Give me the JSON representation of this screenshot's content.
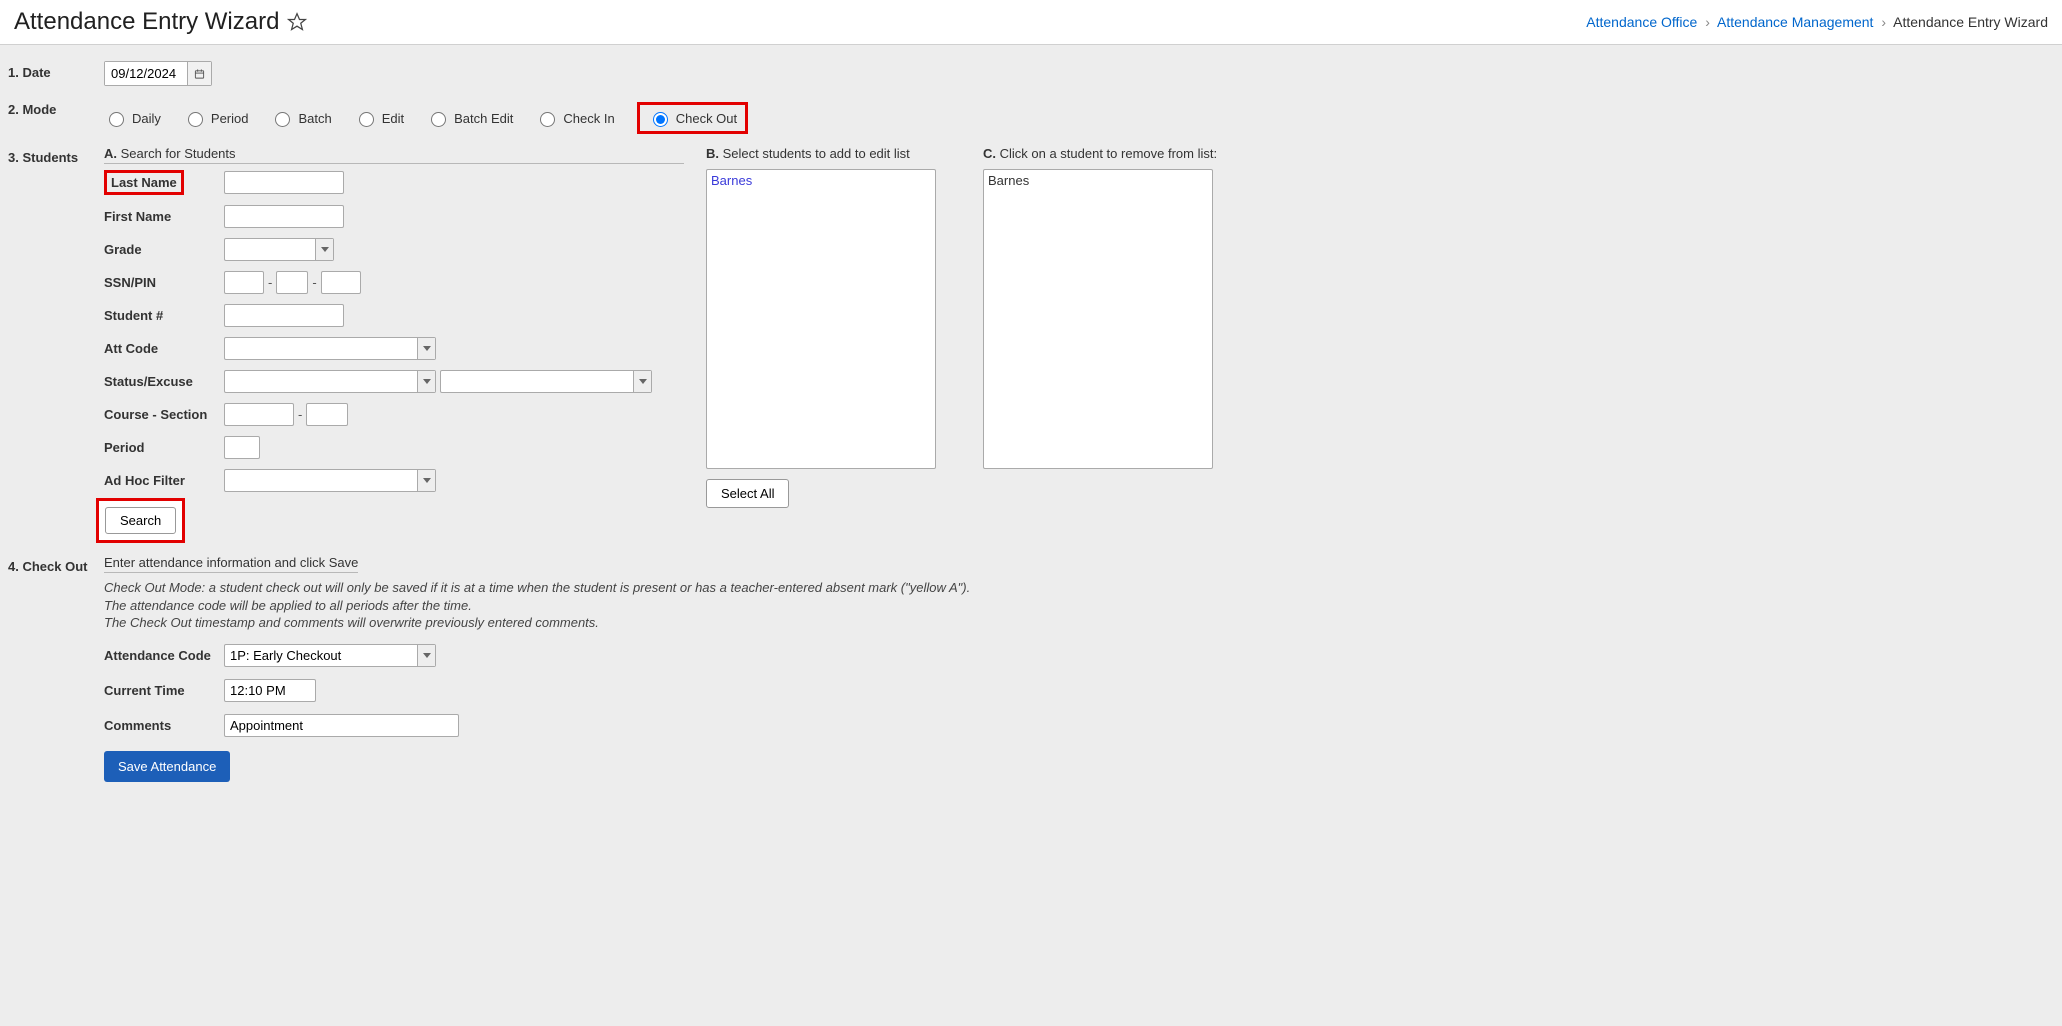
{
  "header": {
    "title": "Attendance Entry Wizard",
    "breadcrumb": [
      {
        "label": "Attendance Office",
        "link": true
      },
      {
        "label": "Attendance Management",
        "link": true
      },
      {
        "label": "Attendance Entry Wizard",
        "link": false
      }
    ]
  },
  "sections": {
    "date_label": "1. Date",
    "mode_label": "2. Mode",
    "students_label": "3. Students",
    "checkout_label": "4. Check Out"
  },
  "date": {
    "value": "09/12/2024"
  },
  "modes": {
    "daily": "Daily",
    "period": "Period",
    "batch": "Batch",
    "edit": "Edit",
    "batch_edit": "Batch Edit",
    "check_in": "Check In",
    "check_out": "Check Out",
    "selected": "check_out"
  },
  "students": {
    "a_head_prefix": "A.",
    "a_head_text": " Search for Students",
    "b_head_prefix": "B.",
    "b_head_text": " Select students to add to edit list",
    "c_head_prefix": "C.",
    "c_head_text": " Click on a student to remove from list:",
    "fields": {
      "last_name": "Last Name",
      "first_name": "First Name",
      "grade": "Grade",
      "ssn": "SSN/PIN",
      "student_no": "Student #",
      "att_code": "Att Code",
      "status_excuse": "Status/Excuse",
      "course_section": "Course - Section",
      "period": "Period",
      "ad_hoc": "Ad Hoc Filter"
    },
    "values": {
      "last_name": "",
      "first_name": "",
      "grade": "",
      "ssn1": "",
      "ssn2": "",
      "ssn3": "",
      "student_no": "",
      "att_code": "",
      "status": "",
      "excuse": "",
      "course": "",
      "section": "",
      "period": "",
      "ad_hoc": ""
    },
    "search_btn": "Search",
    "select_all_btn": "Select All",
    "result_list": [
      {
        "label": "Barnes"
      }
    ],
    "edit_list": [
      {
        "label": "Barnes"
      }
    ]
  },
  "checkout": {
    "hint": "Enter attendance information and click Save",
    "note_line1": "Check Out Mode: a student check out will only be saved if it is at a time when the student is present or has a teacher-entered absent mark (\"yellow A\").",
    "note_line2": "The attendance code will be applied to all periods after the time.",
    "note_line3": "The Check Out timestamp and comments will overwrite previously entered comments.",
    "fields": {
      "att_code": "Attendance Code",
      "current_time": "Current Time",
      "comments": "Comments"
    },
    "values": {
      "att_code": "1P: Early Checkout",
      "current_time": "12:10 PM",
      "comments": "Appointment"
    },
    "save_btn": "Save Attendance"
  }
}
